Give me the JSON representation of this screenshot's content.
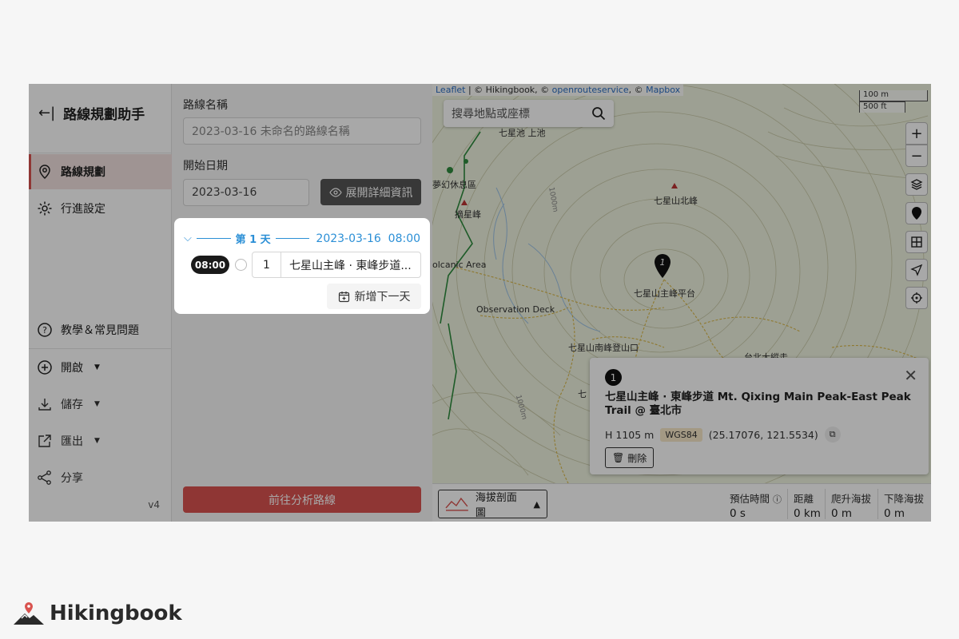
{
  "sidebar": {
    "back_glyph": "←|",
    "title": "路線規劃助手",
    "nav": [
      {
        "label": "路線規劃",
        "icon": "location-pin-icon"
      },
      {
        "label": "行進設定",
        "icon": "gear-icon"
      }
    ],
    "help": "教學＆常見問題",
    "actions": [
      {
        "label": "開啟",
        "icon": "plus-circle-icon",
        "has_caret": true
      },
      {
        "label": "儲存",
        "icon": "download-icon",
        "has_caret": true
      },
      {
        "label": "匯出",
        "icon": "export-icon",
        "has_caret": true
      },
      {
        "label": "分享",
        "icon": "share-icon",
        "has_caret": false
      }
    ],
    "version": "v4"
  },
  "form": {
    "route_name_label": "路線名稱",
    "route_name_placeholder": "2023-03-16 未命名的路線名稱",
    "start_date_label": "開始日期",
    "start_date_value": "2023-03-16",
    "detail_button": "展開詳細資訊",
    "analyze_button": "前往分析路線"
  },
  "day": {
    "day_label": "第 1 天",
    "datetime": "2023-03-16  08:00",
    "time": "08:00",
    "waypoint_index": "1",
    "waypoint_name": "七星山主峰 · 東峰步道...",
    "add_day": "新增下一天"
  },
  "map": {
    "attribution": {
      "leaflet": "Leaflet",
      "mid": "| © Hikingbook, ©",
      "ors": "openrouteservice",
      "sep": ", ©",
      "mapbox": "Mapbox"
    },
    "scale_m": "100 m",
    "scale_ft": "500 ft",
    "search_placeholder": "搜尋地點或座標",
    "labels": {
      "pond": "七星池 上池",
      "rest": "夢幻休息區",
      "peak_north": "七星山北峰",
      "zhaixing": "摘星峰",
      "volcanic": "olcanic Area",
      "observation": "Observation Deck",
      "main_platform": "七星山主峰平台",
      "south_trailhead": "七星山南峰登山口",
      "partial": "台北大縱走",
      "qi": "七",
      "contour1": "1000m",
      "contour2": "1000m"
    },
    "pin_number": "1",
    "controls": [
      "zoom-in-icon",
      "zoom-out-icon",
      "layers-icon",
      "marker-icon",
      "grid-icon",
      "navigate-icon",
      "crosshair-icon"
    ]
  },
  "popup": {
    "number": "1",
    "title": "七星山主峰 · 東峰步道 Mt. Qixing Main Peak-East Peak Trail @ 臺北市",
    "elevation": "H 1105 m",
    "datum": "WGS84",
    "coords": "(25.17076, 121.5534)",
    "delete": "刪除"
  },
  "stats": {
    "profile_button": "海拔剖面圖",
    "items": [
      {
        "label": "預估時間",
        "value": "0 s",
        "has_help": true
      },
      {
        "label": "距離",
        "value": "0 km"
      },
      {
        "label": "爬升海拔",
        "value": "0 m"
      },
      {
        "label": "下降海拔",
        "value": "0 m"
      }
    ]
  },
  "brand": {
    "name": "Hikingbook"
  },
  "colors": {
    "accent": "#d9534f",
    "link": "#2b8fd6",
    "dark": "#1a1a1a"
  }
}
